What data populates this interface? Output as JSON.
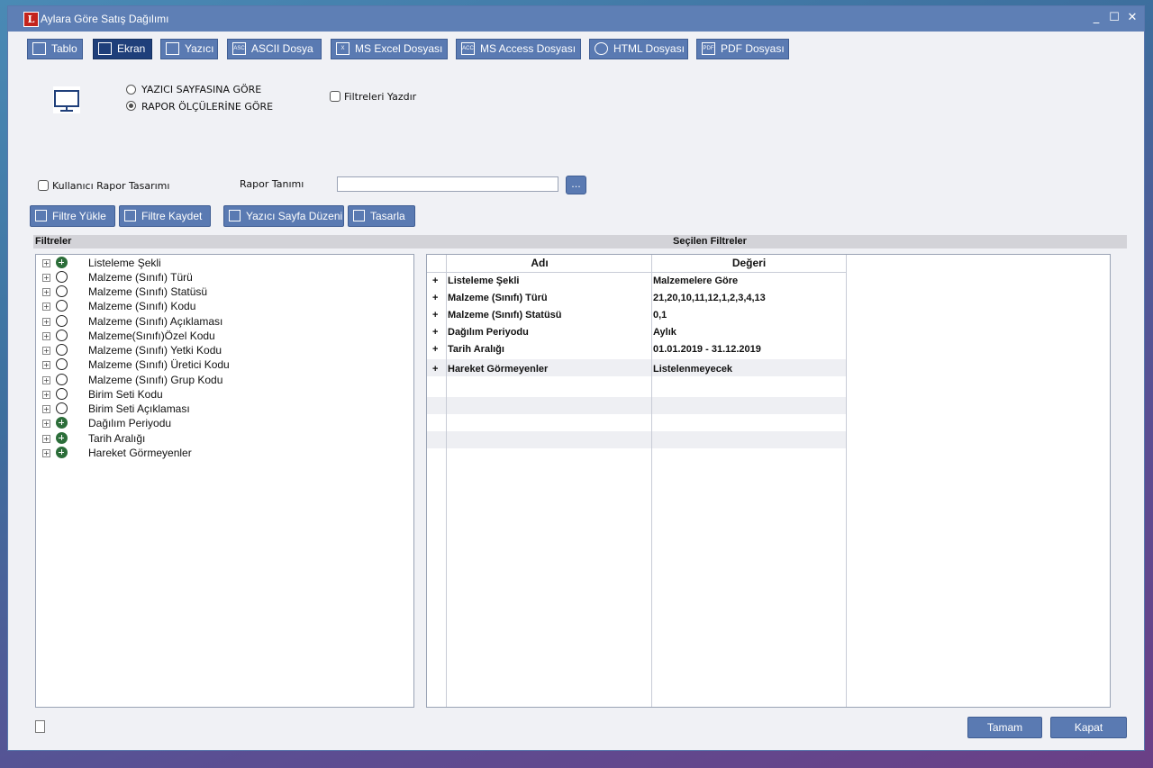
{
  "window": {
    "title": "Aylara Göre Satış Dağılımı",
    "app_icon_letter": "L"
  },
  "controls": {
    "minimize": "_",
    "maximize": "☐",
    "close": "✕"
  },
  "tabs": [
    {
      "label": "Tablo",
      "icon": "table-icon"
    },
    {
      "label": "Ekran",
      "icon": "monitor-icon",
      "active": true
    },
    {
      "label": "Yazıcı",
      "icon": "printer-icon"
    },
    {
      "label": "ASCII Dosya",
      "icon": "ascii-icon",
      "badge": "ASC"
    },
    {
      "label": "MS Excel Dosyası",
      "icon": "excel-icon",
      "badge": "X"
    },
    {
      "label": "MS Access Dosyası",
      "icon": "access-icon",
      "badge": "ACC"
    },
    {
      "label": "HTML Dosyası",
      "icon": "globe-icon"
    },
    {
      "label": "PDF Dosyası",
      "icon": "pdf-icon",
      "badge": "PDF"
    }
  ],
  "output": {
    "radio_printer_page": "YAZICI SAYFASINA GÖRE",
    "radio_report_size": "RAPOR ÖLÇÜLERİNE GÖRE",
    "print_filters": "Filtreleri Yazdır"
  },
  "design": {
    "user_report_design": "Kullanıcı Rapor Tasarımı",
    "report_definition_label": "Rapor Tanımı",
    "report_definition_value": "",
    "browse": "..."
  },
  "buttons": {
    "load_filter": "Filtre Yükle",
    "save_filter": "Filtre Kaydet",
    "page_setup": "Yazıcı Sayfa Düzeni",
    "design": "Tasarla"
  },
  "filters": {
    "header": "Filtreler",
    "items": [
      {
        "label": "Listeleme Şekli",
        "selected": true
      },
      {
        "label": "Malzeme (Sınıfı) Türü",
        "selected": false
      },
      {
        "label": "Malzeme (Sınıfı) Statüsü",
        "selected": false
      },
      {
        "label": "Malzeme (Sınıfı) Kodu",
        "selected": false
      },
      {
        "label": "Malzeme (Sınıfı) Açıklaması",
        "selected": false
      },
      {
        "label": "Malzeme(Sınıfı)Özel Kodu",
        "selected": false
      },
      {
        "label": "Malzeme (Sınıfı) Yetki Kodu",
        "selected": false
      },
      {
        "label": "Malzeme (Sınıfı) Üretici Kodu",
        "selected": false
      },
      {
        "label": "Malzeme (Sınıfı) Grup Kodu",
        "selected": false
      },
      {
        "label": "Birim Seti Kodu",
        "selected": false
      },
      {
        "label": "Birim Seti Açıklaması",
        "selected": false
      },
      {
        "label": "Dağılım Periyodu",
        "selected": true
      },
      {
        "label": "Tarih Aralığı",
        "selected": true
      },
      {
        "label": "Hareket Görmeyenler",
        "selected": true
      }
    ]
  },
  "selected_filters": {
    "header": "Seçilen Filtreler",
    "col_name": "Adı",
    "col_value": "Değeri",
    "rows": [
      {
        "name": "Listeleme Şekli",
        "value": "Malzemelere Göre"
      },
      {
        "name": "Malzeme (Sınıfı) Türü",
        "value": "21,20,10,11,12,1,2,3,4,13"
      },
      {
        "name": "Malzeme (Sınıfı) Statüsü",
        "value": "0,1"
      },
      {
        "name": "Dağılım Periyodu",
        "value": "Aylık"
      },
      {
        "name": "Tarih Aralığı",
        "value": "01.01.2019 - 31.12.2019"
      },
      {
        "name": "Hareket Görmeyenler",
        "value": "Listelenmeyecek"
      }
    ]
  },
  "footer": {
    "ok": "Tamam",
    "close": "Kapat"
  }
}
